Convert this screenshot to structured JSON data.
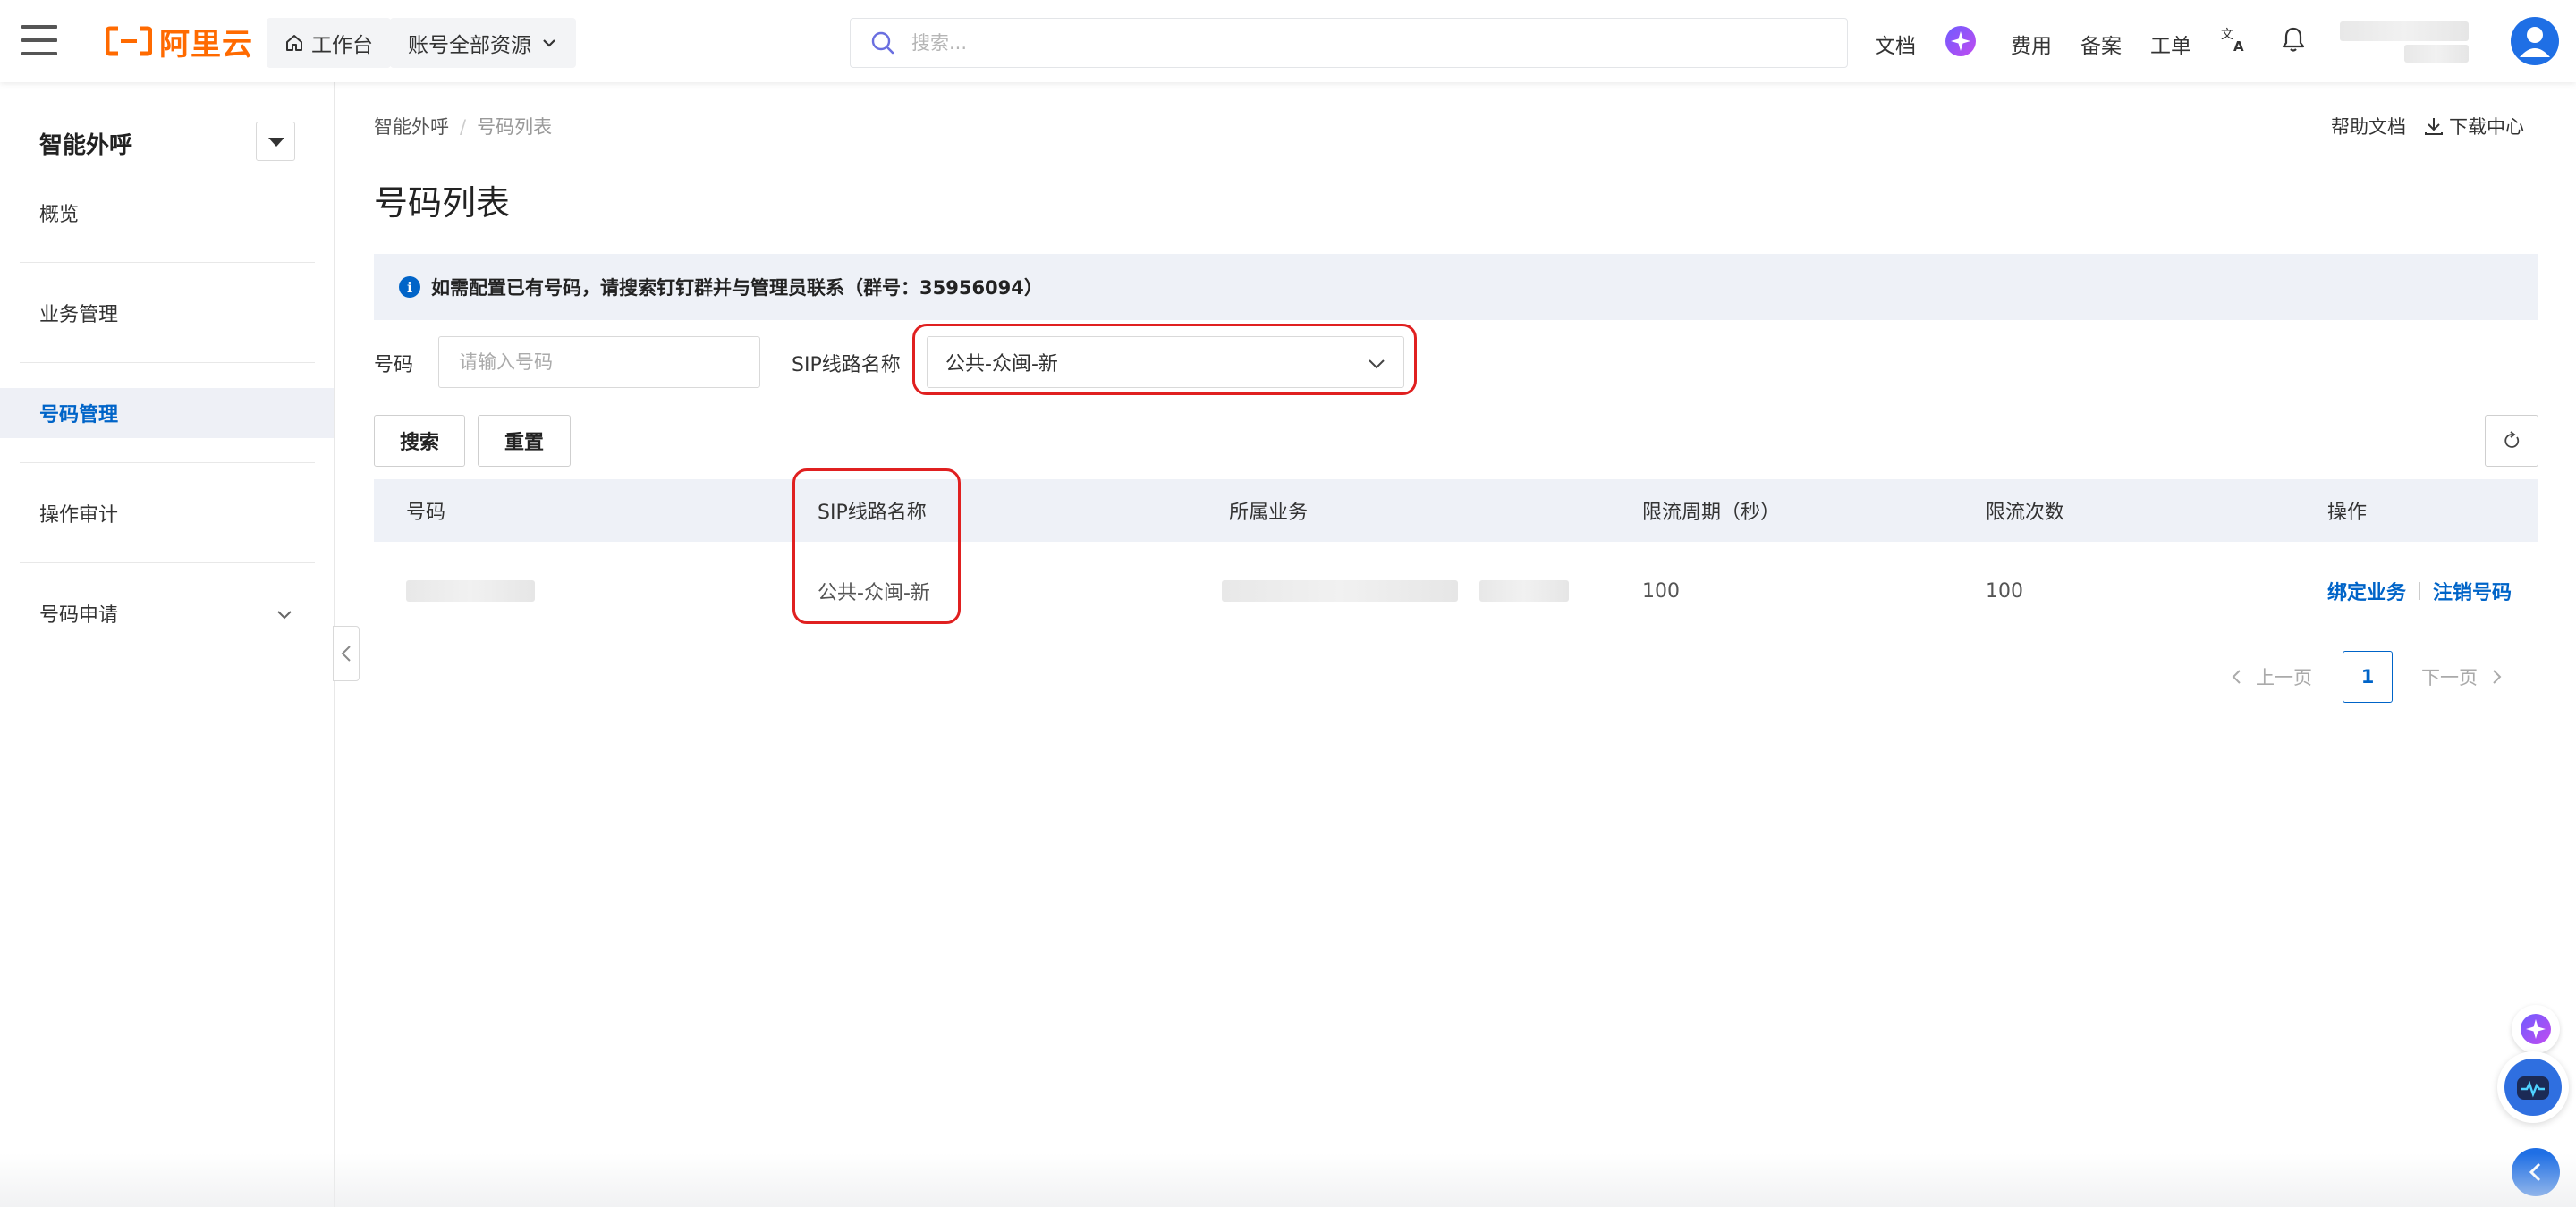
{
  "header": {
    "logo_text": "阿里云",
    "workbench_label": "工作台",
    "resource_label": "账号全部资源",
    "search_placeholder": "搜索...",
    "docs_label": "文档",
    "billing_label": "费用",
    "icp_label": "备案",
    "ticket_label": "工单",
    "brand_color": "#ff6a00"
  },
  "sidebar": {
    "title": "智能外呼",
    "items": [
      {
        "label": "概览"
      },
      {
        "label": "业务管理"
      },
      {
        "label": "号码管理",
        "active": true
      },
      {
        "label": "操作审计"
      },
      {
        "label": "号码申请",
        "expandable": true
      }
    ]
  },
  "breadcrumb": {
    "root": "智能外呼",
    "current": "号码列表"
  },
  "toplinks": {
    "help": "帮助文档",
    "download": "下载中心"
  },
  "page": {
    "title": "号码列表",
    "notice": "如需配置已有号码，请搜索钉钉群并与管理员联系（群号：35956094）"
  },
  "filters": {
    "number_label": "号码",
    "number_placeholder": "请输入号码",
    "sip_label": "SIP线路名称",
    "sip_value": "公共-众闽-新",
    "search_button": "搜索",
    "reset_button": "重置"
  },
  "table": {
    "columns": [
      "号码",
      "SIP线路名称",
      "所属业务",
      "限流周期（秒）",
      "限流次数",
      "操作"
    ],
    "rows": [
      {
        "sip": "公共-众闽-新",
        "period": "100",
        "count": "100",
        "actions": [
          "绑定业务",
          "注销号码"
        ]
      }
    ]
  },
  "pagination": {
    "prev": "上一页",
    "current": "1",
    "next": "下一页"
  },
  "accent_color": "#0064c8",
  "highlight_color": "#e02020"
}
